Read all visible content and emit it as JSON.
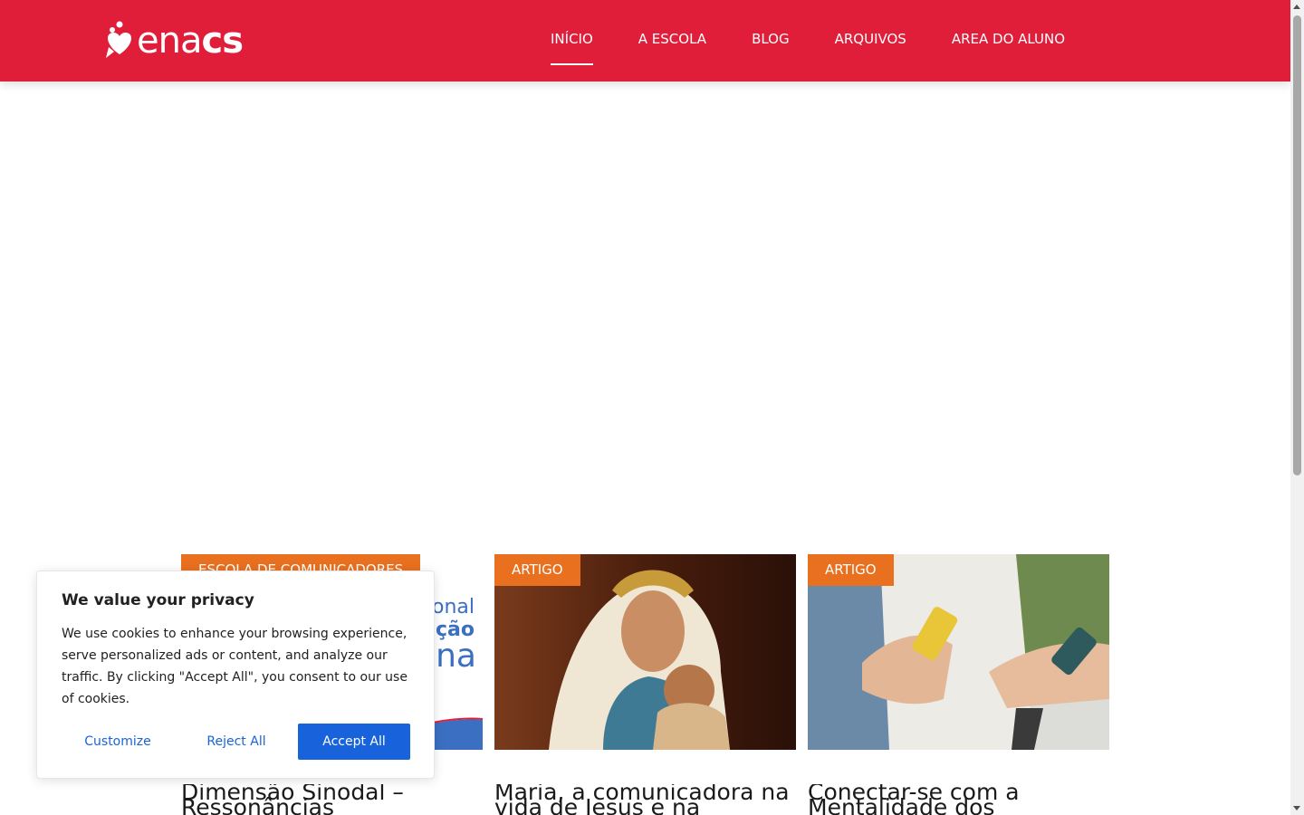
{
  "brand": {
    "logo_text_thin": "ena",
    "logo_text_bold": "cs",
    "primary_color": "#e01e3a"
  },
  "nav": {
    "items": [
      {
        "label": "INÍCIO",
        "active": true
      },
      {
        "label": "A ESCOLA"
      },
      {
        "label": "BLOG"
      },
      {
        "label": "ARQUIVOS"
      },
      {
        "label": "AREA DO ALUNO"
      }
    ]
  },
  "cards": [
    {
      "badge": "ESCOLA DE COMUNICADORES",
      "title": "Dimensão Sinodal – Ressonâncias",
      "image": "event-banner-image"
    },
    {
      "badge": "ARTIGO",
      "title": "Maria, a comunicadora na vida de Jesus e na",
      "image": "mary-and-jesus-statue-image"
    },
    {
      "badge": "ARTIGO",
      "title": "Conectar-se com a Mentalidade dos",
      "image": "people-using-phones-image"
    }
  ],
  "cookie": {
    "title": "We value your privacy",
    "body": "We use cookies to enhance your browsing experience, serve personalized ads or content, and analyze our traffic. By clicking \"Accept All\", you consent to our use of cookies.",
    "customize_label": "Customize",
    "reject_label": "Reject All",
    "accept_label": "Accept All"
  },
  "colors": {
    "badge": "#e8701f",
    "button_blue": "#1863dc"
  }
}
